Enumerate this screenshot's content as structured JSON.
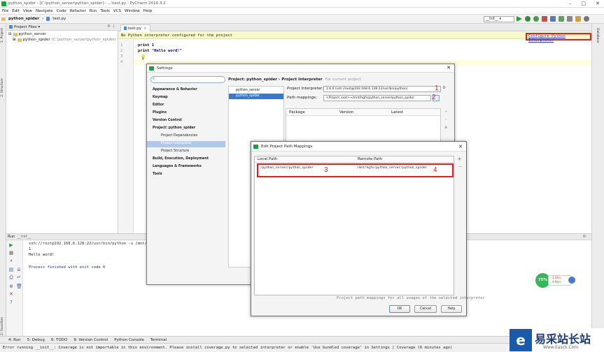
{
  "window": {
    "title": "python_spider - [C:\\python_server\\python_spider] - ...\\test.py - PyCharm 2016.3.2"
  },
  "menu": [
    "File",
    "Edit",
    "View",
    "Navigate",
    "Code",
    "Refactor",
    "Run",
    "Tools",
    "VCS",
    "Window",
    "Help"
  ],
  "nav": {
    "project": "python_spider",
    "file": "test.py",
    "run_config": "__init__"
  },
  "project_panel": {
    "header": "Project Files ▾",
    "root": "python_server",
    "child": "python_spider",
    "child_path": "(C:\\python_server\\python_spider)"
  },
  "editor": {
    "tab": "test.py",
    "warning": "No Python interpreter configured for the project",
    "configure_link": "Configure Python Interpreter",
    "line_numbers": [
      "1",
      "2",
      "3",
      "4"
    ],
    "lines": [
      "print 1",
      "print \"Hello word!\"",
      "",
      ""
    ]
  },
  "side_tabs": {
    "left": [
      "1: Project",
      "2: Structure",
      "2: Favorites"
    ],
    "right": [
      "Database"
    ]
  },
  "run": {
    "header": "Run",
    "config": "__init__",
    "command": "ssh://root@192.168.6.128:22/usr/bin/python -u /mnt/hgfs/pyth",
    "out1": "1",
    "out2": "Hello word!",
    "out3": "Process finished with exit code 0"
  },
  "bottom_tabs": [
    "4: Run",
    "5: Debug",
    "6: TODO",
    "9: Version Control",
    "Python Console",
    "Terminal"
  ],
  "status": "Error running __init__: Coverage is not importable in this environment. Please install coverage.py to selected interpreter or enable 'Use bundled coverage' in Settings | Coverage (6 minutes ago)",
  "settings": {
    "title": "Settings",
    "search_placeholder": "",
    "nav": [
      {
        "label": "Appearance & Behavior",
        "bold": true
      },
      {
        "label": "Keymap",
        "bold": true
      },
      {
        "label": "Editor",
        "bold": true
      },
      {
        "label": "Plugins",
        "bold": true
      },
      {
        "label": "Version Control",
        "bold": true
      },
      {
        "label": "Project: python_spider",
        "bold": true
      },
      {
        "label": "Project Dependencies",
        "bold": false
      },
      {
        "label": "Project Interpreter",
        "bold": false
      },
      {
        "label": "Project Structure",
        "bold": false
      },
      {
        "label": "Build, Execution, Deployment",
        "bold": true
      },
      {
        "label": "Languages & Frameworks",
        "bold": true
      },
      {
        "label": "Tools",
        "bold": true
      }
    ],
    "breadcrumb": "Project: python_spider › Project Interpreter",
    "breadcrumb_note": "For current project",
    "projects": [
      "python_server",
      "python_spider"
    ],
    "interpreter_label": "Project Interpreter:",
    "interpreter_value": "2.6.6 (ssh://root@192.168.6.128:22/usr/bin/python)",
    "path_label": "Path mappings:",
    "path_value": "<Project root>→/mnt/hgfs/python_server/python_spider",
    "pkg_headers": [
      "Package",
      "Version",
      "Latest"
    ]
  },
  "mapping_dialog": {
    "title": "Edit Project Path Mappings",
    "col_local": "Local Path",
    "col_remote": "Remote Path",
    "local": "/python_server/python_spider",
    "remote": "/mnt/hgfs/python_server/python_spider",
    "note": "Project path mappings for all usages of the selected interpreter",
    "ok": "OK",
    "cancel": "Cancel",
    "help": "Help"
  },
  "annotations": [
    "1",
    "2",
    "3",
    "4"
  ],
  "memory": {
    "percent": "75%",
    "up": "1.5K/s",
    "down": "4.9K/s"
  },
  "watermark": {
    "brand": "易采站长站",
    "url": "Www.Easck.Com"
  }
}
